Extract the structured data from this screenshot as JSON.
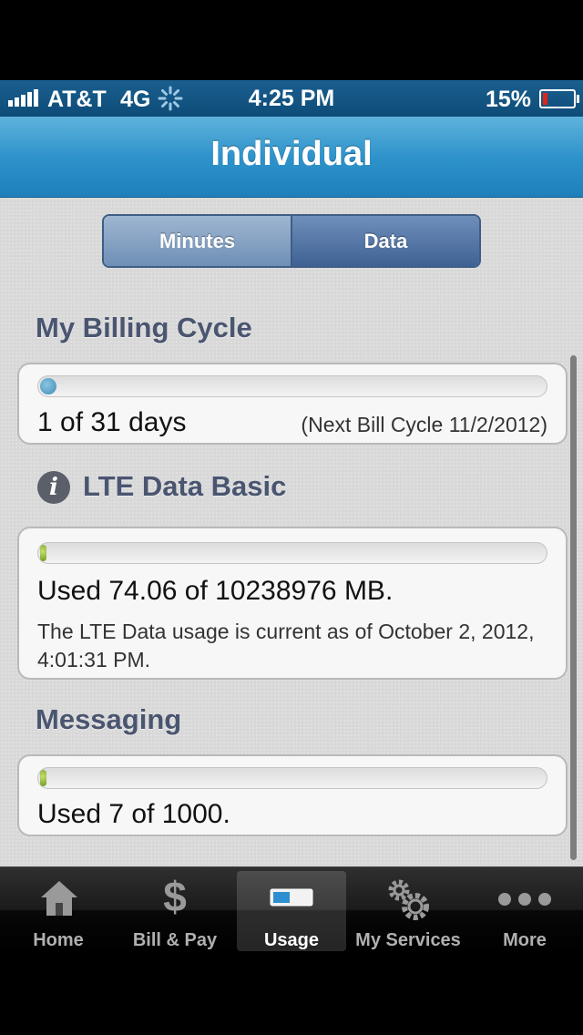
{
  "status_bar": {
    "carrier": "AT&T",
    "network": "4G",
    "time": "4:25 PM",
    "battery": "15%"
  },
  "nav": {
    "title": "Individual"
  },
  "segment": {
    "options": [
      "Minutes",
      "Data"
    ],
    "selected": "Data"
  },
  "billing": {
    "title": "My Billing Cycle",
    "progress": 0.032,
    "days_text": "1 of 31 days",
    "next_cycle": "(Next Bill Cycle 11/2/2012)"
  },
  "lte": {
    "title": "LTE Data Basic",
    "progress": 0.0,
    "used_text": "Used 74.06 of 10238976 MB.",
    "note": "The LTE Data usage is current as of October 2, 2012, 4:01:31 PM."
  },
  "messaging": {
    "title": "Messaging",
    "progress": 0.007,
    "used_text": "Used 7 of 1000."
  },
  "tabbar": {
    "items": [
      {
        "label": "Home",
        "icon": "house-icon"
      },
      {
        "label": "Bill & Pay",
        "icon": "dollar-icon"
      },
      {
        "label": "Usage",
        "icon": "usage-meter-icon"
      },
      {
        "label": "My Services",
        "icon": "gears-icon"
      },
      {
        "label": "More",
        "icon": "more-dots-icon"
      }
    ],
    "active": "Usage"
  },
  "colors": {
    "nav_blue": "#2f93cb",
    "segment_selected": "#3f6294",
    "progress_blue": "#3b8bb5",
    "progress_green": "#6f9a1d"
  }
}
